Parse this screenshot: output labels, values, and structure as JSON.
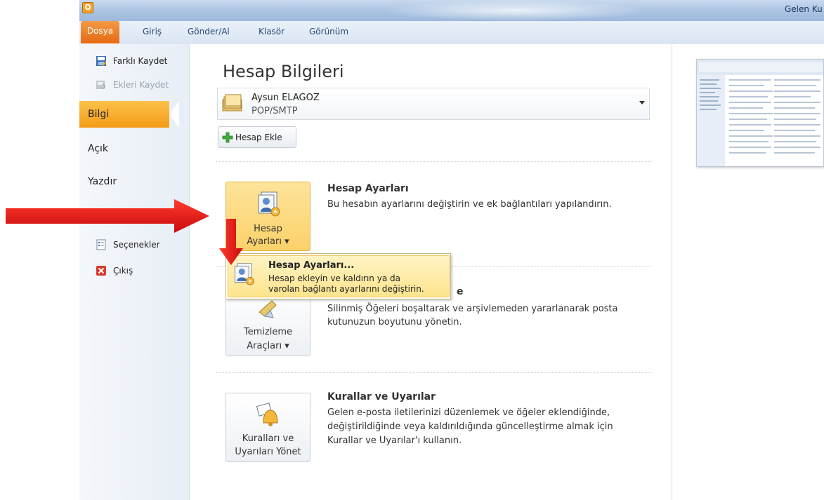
{
  "window": {
    "title": "Gelen Ku",
    "app_icon": "O"
  },
  "ribbon": {
    "file_tab": "Dosya",
    "tabs": [
      "Giriş",
      "Gönder/Al",
      "Klasör",
      "Görünüm"
    ]
  },
  "nav": {
    "save_as": "Farklı Kaydet",
    "save_attachments": "Ekleri Kaydet",
    "info": "Bilgi",
    "open": "Açık",
    "print": "Yazdır",
    "options": "Seçenekler",
    "exit": "Çıkış"
  },
  "main": {
    "title": "Hesap Bilgileri",
    "account": {
      "name": "Aysun ELAGOZ",
      "type": "POP/SMTP"
    },
    "add_account_button": "Hesap Ekle",
    "sections": [
      {
        "button_line1": "Hesap",
        "button_line2": "Ayarları ▾",
        "title": "Hesap Ayarları",
        "desc1": "Bu hesabın ayarlarını değiştirin ve ek bağlantıları yapılandırın."
      },
      {
        "button_line1": "Temizleme",
        "button_line2": "Araçları ▾",
        "title_partial": "e",
        "desc1": "Silinmiş Öğeleri boşaltarak ve arşivlemeden yararlanarak posta",
        "desc2": "kutunuzun boyutunu yönetin."
      },
      {
        "button_line1": "Kuralları ve",
        "button_line2": "Uyarıları Yönet",
        "title": "Kurallar ve Uyarılar",
        "desc1": "Gelen e-posta iletilerinizi düzenlemek ve öğeler eklendiğinde,",
        "desc2": "değiştirildiğinde veya kaldırıldığında güncelleştirme almak için",
        "desc3": "Kurallar ve Uyarılar'ı kullanın."
      }
    ]
  },
  "popup": {
    "title": "Hesap Ayarları...",
    "desc1": "Hesap ekleyin ve kaldırın ya da",
    "desc2": "varolan bağlantı ayarlarını değiştirin."
  },
  "colors": {
    "accent_orange": "#f59c17",
    "file_tab": "#e56a12",
    "annotation_red": "#e01010"
  }
}
